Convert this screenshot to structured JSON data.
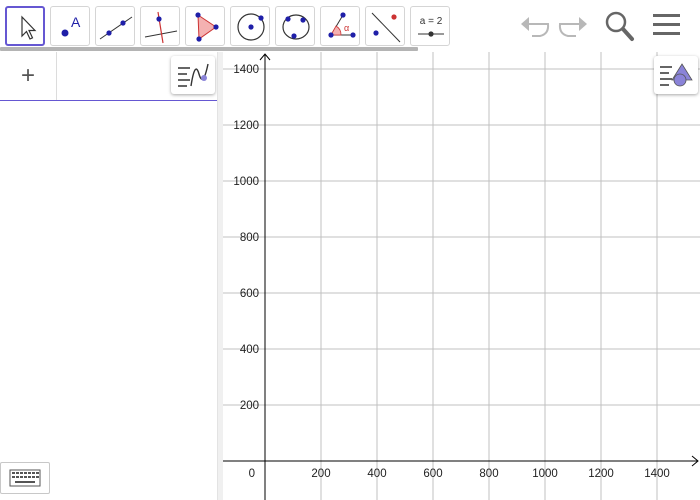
{
  "toolbar": {
    "tools": [
      {
        "name": "move-tool",
        "icon": "arrow-cursor-icon"
      },
      {
        "name": "point-tool",
        "icon": "point-icon",
        "label": "A"
      },
      {
        "name": "line-tool",
        "icon": "line-through-two-points-icon"
      },
      {
        "name": "perpendicular-line-tool",
        "icon": "perpendicular-line-icon"
      },
      {
        "name": "polygon-tool",
        "icon": "polygon-icon"
      },
      {
        "name": "circle-center-point-tool",
        "icon": "circle-center-point-icon"
      },
      {
        "name": "circle-three-points-tool",
        "icon": "circle-three-points-icon"
      },
      {
        "name": "angle-tool",
        "icon": "angle-icon",
        "label": "α"
      },
      {
        "name": "reflect-tool",
        "icon": "reflect-about-line-icon"
      },
      {
        "name": "slider-tool",
        "icon": "slider-icon",
        "label": "a = 2"
      }
    ],
    "selected": "move-tool",
    "right": [
      "undo-icon",
      "redo-icon",
      "search-icon",
      "menu-icon"
    ]
  },
  "algebra": {
    "add_label": "+",
    "style_icon": "algebra-style-icon"
  },
  "graphics": {
    "style_icon": "graphics-style-icon",
    "origin_label": "0"
  },
  "chart_data": {
    "type": "scatter",
    "title": "",
    "xlabel": "",
    "ylabel": "",
    "xlim": [
      -150,
      1555
    ],
    "ylim": [
      -130,
      1470
    ],
    "x_ticks": [
      "200",
      "400",
      "600",
      "800",
      "1000",
      "1200",
      "1400"
    ],
    "y_ticks": [
      "200",
      "400",
      "600",
      "800",
      "1000",
      "1200",
      "1400"
    ],
    "x_tick_values": [
      200,
      400,
      600,
      800,
      1000,
      1200,
      1400
    ],
    "y_tick_values": [
      200,
      400,
      600,
      800,
      1000,
      1200,
      1400
    ],
    "grid": true,
    "series": []
  },
  "colors": {
    "accent": "#6557d2",
    "grid": "#c0c0c0",
    "axis": "#000000",
    "point": "#1f1fa8",
    "polygon_fill": "#f4b1b1"
  },
  "keyboard_icon": "keyboard-icon"
}
